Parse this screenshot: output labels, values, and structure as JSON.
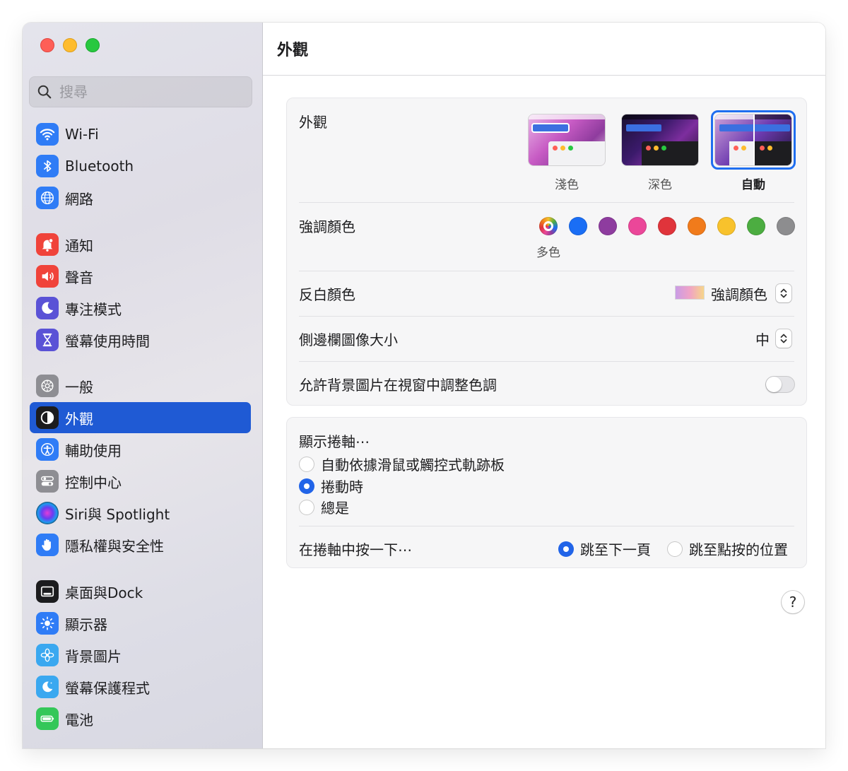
{
  "search": {
    "placeholder": "搜尋"
  },
  "sidebar": {
    "items": [
      {
        "label": "Wi-Fi",
        "icon": "wifi-icon",
        "color": "#2f7cf6"
      },
      {
        "label": "Bluetooth",
        "icon": "bluetooth-icon",
        "color": "#2f7cf6"
      },
      {
        "label": "網路",
        "icon": "globe-icon",
        "color": "#2f7cf6"
      },
      {
        "label": "通知",
        "icon": "bell-icon",
        "color": "#f0433a"
      },
      {
        "label": "聲音",
        "icon": "speaker-icon",
        "color": "#f0433a"
      },
      {
        "label": "專注模式",
        "icon": "moon-icon",
        "color": "#5a52d6"
      },
      {
        "label": "螢幕使用時間",
        "icon": "hourglass-icon",
        "color": "#5a52d6"
      },
      {
        "label": "一般",
        "icon": "gear-icon",
        "color": "#8e8e93"
      },
      {
        "label": "外觀",
        "icon": "appearance-icon",
        "color": "#1c1c1e"
      },
      {
        "label": "輔助使用",
        "icon": "accessibility-icon",
        "color": "#2f7cf6"
      },
      {
        "label": "控制中心",
        "icon": "control-center-icon",
        "color": "#8e8e93"
      },
      {
        "label": "Siri與 Spotlight",
        "icon": "siri-icon",
        "color": "#222"
      },
      {
        "label": "隱私權與安全性",
        "icon": "hand-icon",
        "color": "#2f7cf6"
      },
      {
        "label": "桌面與Dock",
        "icon": "dock-icon",
        "color": "#1c1c1e"
      },
      {
        "label": "顯示器",
        "icon": "sun-icon",
        "color": "#2f7cf6"
      },
      {
        "label": "背景圖片",
        "icon": "flower-icon",
        "color": "#3aa8f0"
      },
      {
        "label": "螢幕保護程式",
        "icon": "screensaver-icon",
        "color": "#3aa8f0"
      },
      {
        "label": "電池",
        "icon": "battery-icon",
        "color": "#34c759"
      }
    ]
  },
  "main": {
    "title": "外觀",
    "appearance": {
      "label": "外觀",
      "options": [
        {
          "caption": "淺色"
        },
        {
          "caption": "深色"
        },
        {
          "caption": "自動"
        }
      ]
    },
    "accent": {
      "label": "強調顏色",
      "selected_caption": "多色",
      "colors": [
        "multicolor",
        "#1a6ef5",
        "#8e3c9f",
        "#eb4799",
        "#e0343b",
        "#f17b1b",
        "#f8c22c",
        "#4cad41",
        "#8d8d8f"
      ]
    },
    "highlight": {
      "label": "反白顏色",
      "value": "強調顏色"
    },
    "sidebar_icon_size": {
      "label": "側邊欄圖像大小",
      "value": "中"
    },
    "wallpaper_tint": {
      "label": "允許背景圖片在視窗中調整色調"
    },
    "scrollbars": {
      "label": "顯示捲軸⋯",
      "options": [
        "自動依據滑鼠或觸控式軌跡板",
        "捲動時",
        "總是"
      ]
    },
    "click_scrollbar": {
      "label": "在捲軸中按一下⋯",
      "options": [
        "跳至下一頁",
        "跳至點按的位置"
      ]
    },
    "help": "?"
  }
}
